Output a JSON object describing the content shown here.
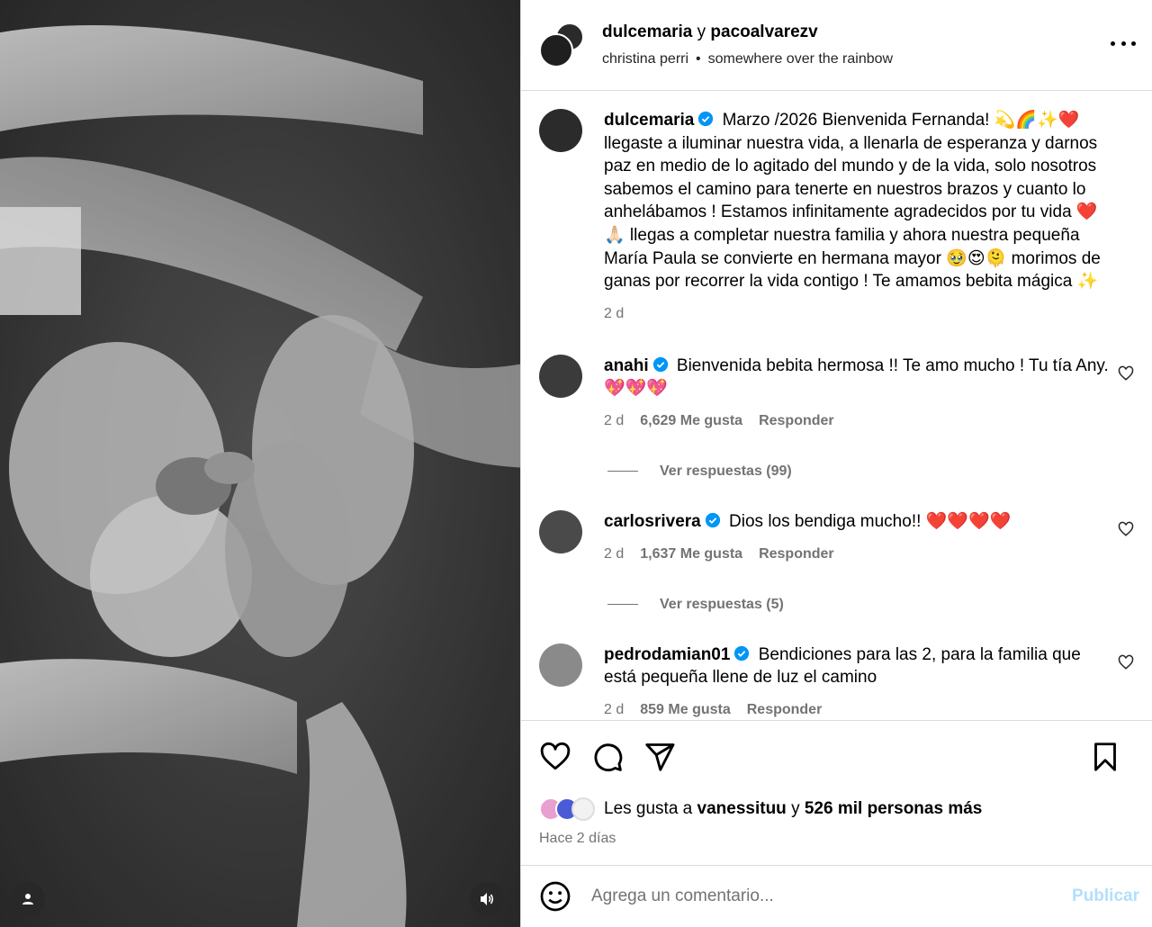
{
  "header": {
    "user1": "dulcemaria",
    "connector": "y",
    "user2": "pacoalvarezv",
    "audio_artist": "christina perri",
    "audio_sep": "•",
    "audio_song": "somewhere over the rainbow"
  },
  "caption": {
    "user": "dulcemaria",
    "text": "Marzo /2026 Bienvenida Fernanda! 💫🌈✨❤️ llegaste a iluminar nuestra vida, a llenarla de esperanza y darnos paz en medio de lo agitado del mundo y de la vida, solo nosotros sabemos el camino para tenerte en nuestros brazos y cuanto lo anhelábamos ! Estamos infinitamente agradecidos por tu vida ❤️🙏🏻 llegas a completar nuestra familia y ahora nuestra pequeña María Paula se convierte en hermana mayor 🥹😍🫠 morimos de ganas por recorrer la vida contigo ! Te amamos bebita mágica ✨",
    "time": "2 d"
  },
  "comments": [
    {
      "user": "anahi",
      "text": "Bienvenida bebita hermosa !! Te amo mucho ! Tu tía Any. 💖💖💖",
      "time": "2 d",
      "likes": "6,629 Me gusta",
      "reply": "Responder",
      "replies": "Ver respuestas (99)"
    },
    {
      "user": "carlosrivera",
      "text": "Dios los bendiga mucho!! ❤️❤️❤️❤️",
      "time": "2 d",
      "likes": "1,637 Me gusta",
      "reply": "Responder",
      "replies": "Ver respuestas (5)"
    },
    {
      "user": "pedrodamian01",
      "text": "Bendiciones para las 2, para la familia que está pequeña llene de luz el camino",
      "time": "2 d",
      "likes": "859 Me gusta",
      "reply": "Responder"
    }
  ],
  "likes": {
    "prefix": "Les gusta a",
    "user": "vanessituu",
    "connector": "y",
    "others": "526 mil personas más"
  },
  "posted": "Hace 2 días",
  "comment_box": {
    "placeholder": "Agrega un comentario...",
    "publish": "Publicar"
  },
  "icons": {
    "more": "more-options-icon",
    "like": "heart-icon",
    "comment": "comment-icon",
    "share": "send-icon",
    "save": "bookmark-icon",
    "emoji": "emoji-icon",
    "user_tags": "user-icon",
    "sound": "speaker-icon"
  },
  "colors": {
    "verified": "#0095f6",
    "muted_text": "#737373",
    "publish_disabled": "#b2dffc",
    "divider": "#dbdbdb"
  }
}
